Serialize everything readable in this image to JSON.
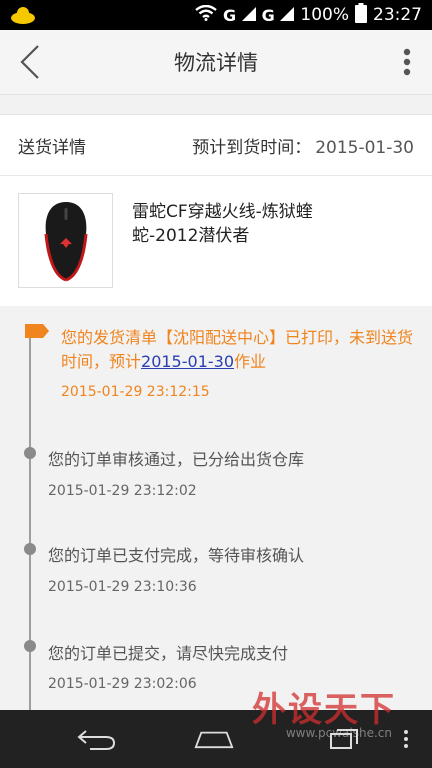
{
  "status_bar": {
    "signal1": "G",
    "signal2": "G",
    "battery": "100%",
    "time": "23:27"
  },
  "header": {
    "title": "物流详情",
    "back_icon": "chevron-left-icon",
    "more_icon": "more-vertical-icon"
  },
  "delivery": {
    "label": "送货详情",
    "eta_label": "预计到货时间：",
    "eta_date": "2015-01-30"
  },
  "product": {
    "name": "雷蛇CF穿越火线-炼狱蝰蛇-2012潜伏者"
  },
  "timeline": {
    "items": [
      {
        "text_part1": "您的发货清单【沈阳配送中心】已打印，未到送货时间，预计",
        "text_link": "2015-01-30",
        "text_part2": "作业",
        "time": "2015-01-29 23:12:15"
      },
      {
        "text": "您的订单审核通过，已分给出货仓库",
        "time": "2015-01-29  23:12:02"
      },
      {
        "text": "您的订单已支付完成，等待审核确认",
        "time": "2015-01-29  23:10:36"
      },
      {
        "text": "您的订单已提交，请尽快完成支付",
        "time": "2015-01-29  23:02:06"
      }
    ]
  },
  "watermark": {
    "brand": "外设天下",
    "url": "www.pcwaishe.cn"
  },
  "colors": {
    "accent": "#f0841e",
    "link": "#2b3fb3",
    "nav_bar": "#222222"
  }
}
